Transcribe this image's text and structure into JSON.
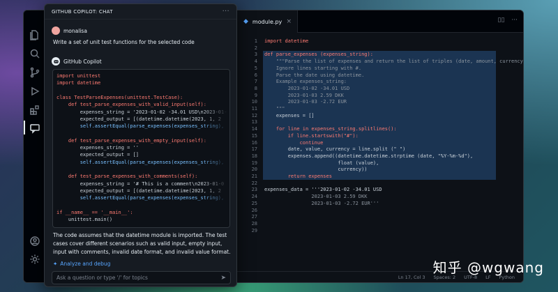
{
  "chat": {
    "header": "GITHUB COPILOT: CHAT",
    "more": "···",
    "user": "monalisa",
    "prompt": "Write a set of unit test functions for the selected code",
    "bot": "GitHub Copilot",
    "code": [
      "import unittest",
      "import datetime",
      "",
      "class TestParseExpenses(unittest.TestCase):",
      "    def test_parse_expenses_with_valid_input(self):",
      "        expenses_string = '2023-01-02 -34.01 USD\\n2023-01-",
      "        expected_output = [(datetime.datetime(2023, 1, 2",
      "        self.assertEqual(parse_expenses(expenses_string),",
      "",
      "    def test_parse_expenses_with_empty_input(self):",
      "        expenses_string = ''",
      "        expected_output = []",
      "        self.assertEqual(parse_expenses(expenses_string),",
      "",
      "    def test_parse_expenses_with_comments(self):",
      "        expenses_string = '# This is a comment\\n2023-01-0",
      "        expected_output = [(datetime.datetime(2023, 1, 2",
      "        self.assertEqual(parse_expenses(expenses_string),",
      "",
      "if __name__ == '__main__':",
      "    unittest.main()"
    ],
    "explanation": "The code assumes that the datetime module is imported. The test cases cover different scenarios such as valid input, empty input, input with comments, invalid date format, and invalid value format.",
    "analyze": "Analyze and debug",
    "placeholder": "Ask a question or type '/' for topics"
  },
  "editor": {
    "tab": "module.py",
    "close": "×",
    "lines": [
      "import datetime",
      "",
      "def parse_expenses (expenses_string):",
      "    \"\"\"Parse the list of expenses and return the list of triples (date, amount, currency).",
      "    Ignore lines starting with #.",
      "    Parse the date using datetime.",
      "    Example expenses_string:",
      "        2023-01-02 -34.01 USD",
      "        2023-01-03 2.59 DKK",
      "        2023-01-03 -2.72 EUR",
      "    \"\"\"",
      "    expenses = []",
      "",
      "    for line in expenses_string.splitlines():",
      "        if line.startswith(\"#\"):",
      "            continue",
      "        date, value, currency = line.split (\" \")",
      "        expenses.append((datetime.datetime.strptime (date, \"%Y-%m-%d\"),",
      "                         float (value),",
      "                         currency))",
      "        return expenses",
      "",
      "expenses_data = '''2023-01-02 -34.01 USD",
      "                2023-01-03 2.59 DKK",
      "                2023-01-03 -2.72 EUR'''",
      "",
      "",
      "",
      ""
    ]
  },
  "status": {
    "position": "Ln 17, Col 3",
    "spaces": "Spaces: 2",
    "encoding": "UTF-8",
    "eol": "LF",
    "lang": "Python"
  },
  "watermark": "知乎 @wgwang",
  "edge_text": "ma"
}
